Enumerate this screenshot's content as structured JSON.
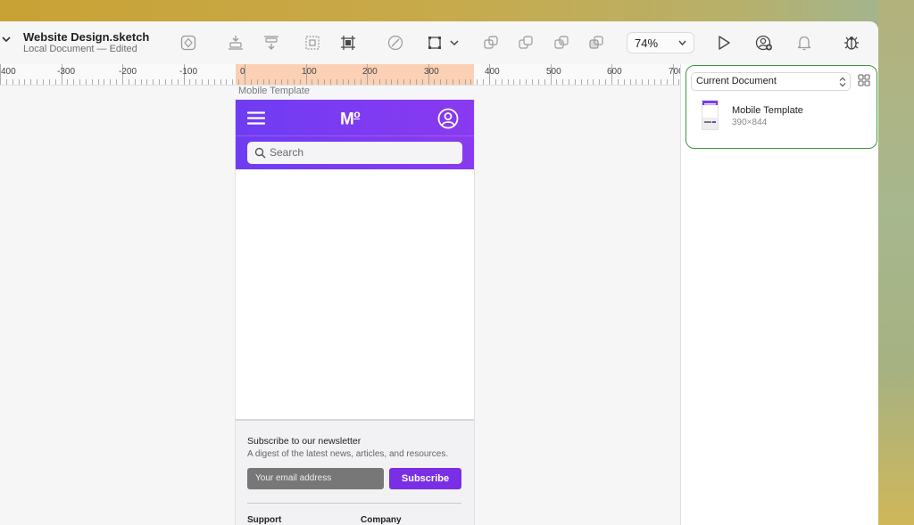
{
  "window": {
    "title": "Website Design.sketch",
    "subtitle": "Local Document — Edited"
  },
  "toolbar": {
    "zoom": "74%",
    "icons": [
      "insert-icon",
      "align-icon",
      "distribute-icon",
      "group-icon",
      "frame-icon",
      "edit-icon",
      "mask-icon",
      "union-icon",
      "subtract-icon",
      "intersect-icon",
      "difference-icon",
      "play-icon",
      "add-collaborator-icon",
      "notifications-icon",
      "bug-icon"
    ]
  },
  "ruler": {
    "labels": [
      "400",
      "-300",
      "-200",
      "-100",
      "0",
      "100",
      "200",
      "300",
      "400",
      "500",
      "600",
      "700"
    ],
    "highlight_color": "#fbd0b4"
  },
  "artboard": {
    "label": "Mobile Template",
    "header_color": "#7a3af0",
    "logo": "Mo",
    "search_placeholder": "Search",
    "newsletter_title": "Subscribe to our newsletter",
    "newsletter_desc": "A digest of the latest news, articles, and resources.",
    "email_placeholder": "Your email address",
    "subscribe_label": "Subscribe",
    "footer_cols": [
      "Support",
      "Company"
    ]
  },
  "sidebar": {
    "document_select": "Current Document",
    "templates": [
      {
        "name": "Mobile Template",
        "size": "390×844"
      }
    ],
    "highlight_color": "#3a9a3a"
  }
}
